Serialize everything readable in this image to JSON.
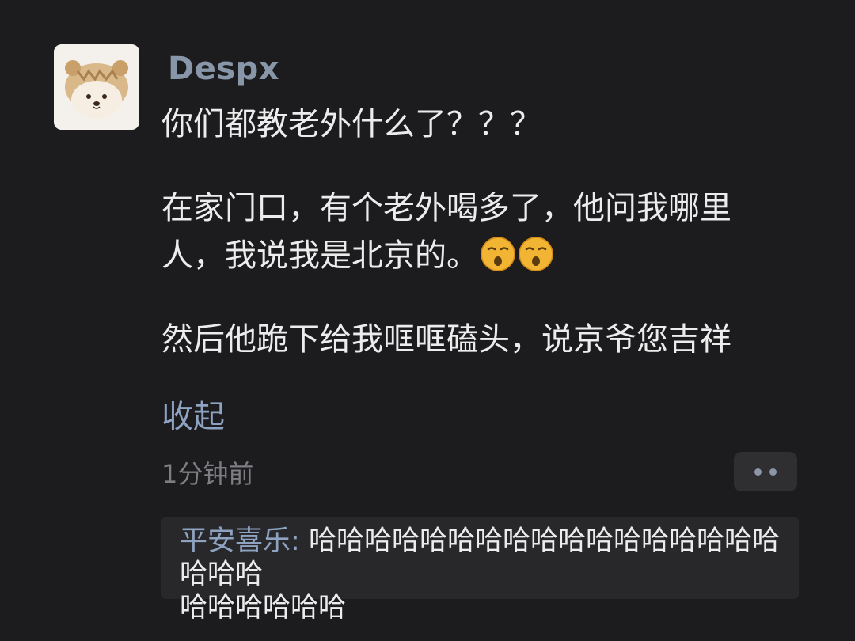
{
  "post": {
    "author": "Despx",
    "content_lines": {
      "p1": "你们都教老外什么了？？？",
      "p2_l1": "在家门口，有个老外喝多了，他问我哪里",
      "p2_l2": "人，我说我是北京的。",
      "p3": "然后他跪下给我哐哐磕头，说京爷您吉祥"
    },
    "emojis": [
      "kissing-face-icon",
      "kissing-face-icon"
    ],
    "collapse_label": "收起",
    "timestamp": "1分钟前"
  },
  "reply": {
    "name": "平安喜乐",
    "separator": ": ",
    "text_l1": "哈哈哈哈哈哈哈哈哈哈哈哈哈哈哈哈哈哈哈哈",
    "text_l2": "哈哈哈哈哈哈"
  },
  "colors": {
    "background": "#1c1c1e",
    "author": "#8896a9",
    "link": "#8ea2c2",
    "muted": "#7d7d82",
    "reply_bg": "#28282b"
  }
}
